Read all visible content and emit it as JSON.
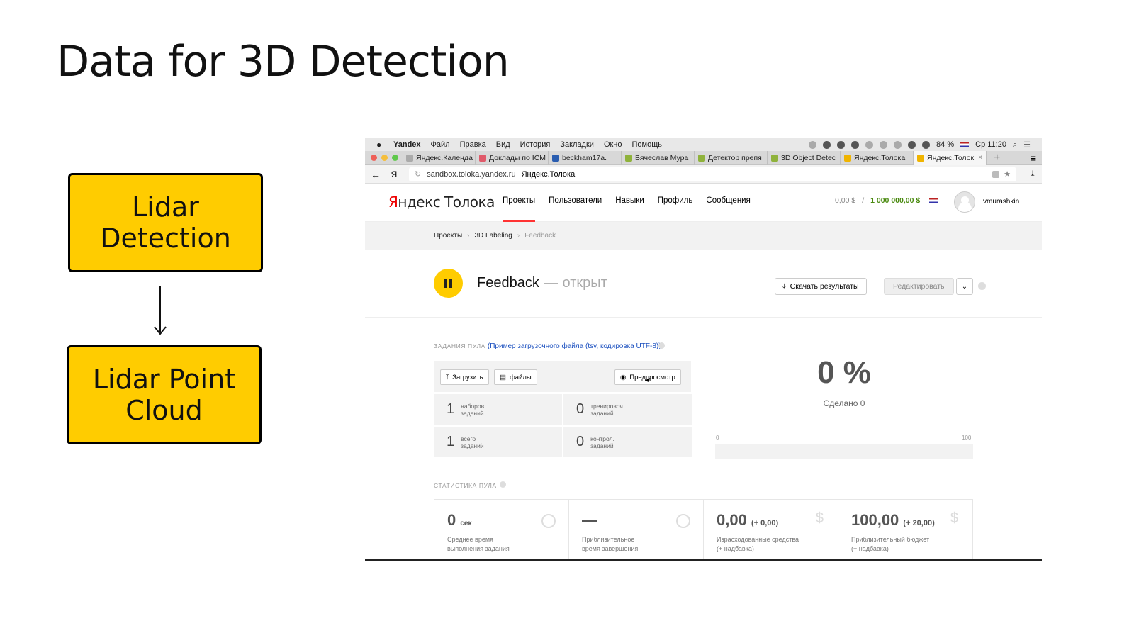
{
  "slide": {
    "title": "Data for 3D Detection",
    "box1": "Lidar\nDetection",
    "box2": "Lidar Point\nCloud"
  },
  "mac_menubar": {
    "app": "Yandex",
    "items": [
      "Файл",
      "Правка",
      "Вид",
      "История",
      "Закладки",
      "Окно",
      "Помощь"
    ],
    "battery": "84 %",
    "clock": "Ср 11:20"
  },
  "tabs": [
    {
      "label": "Яндекс.Календа",
      "color": "#aaaaaa"
    },
    {
      "label": "Доклады по ICM",
      "color": "#e05a6a"
    },
    {
      "label": "beckham17a.",
      "color": "#2a5db0"
    },
    {
      "label": "Вячеслав Мура",
      "color": "#8fb23b"
    },
    {
      "label": "Детектор препя",
      "color": "#8fb23b"
    },
    {
      "label": "3D Object Detec",
      "color": "#8fb23b"
    },
    {
      "label": "Яндекс.Толока",
      "color": "#f0b400"
    },
    {
      "label": "Яндекс.Толок",
      "color": "#f0b400",
      "active": true
    }
  ],
  "address": {
    "host": "sandbox.toloka.yandex.ru",
    "page_title": "Яндекс.Толока"
  },
  "header": {
    "logo_red": "Я",
    "logo_rest": "ндекс Толока",
    "nav": [
      "Проекты",
      "Пользователи",
      "Навыки",
      "Профиль",
      "Сообщения"
    ],
    "balance_zero": "0,00 $",
    "balance_sep": "/",
    "balance_main": "1 000 000,00 $",
    "username": "vmurashkin"
  },
  "breadcrumbs": [
    "Проекты",
    "3D Labeling",
    "Feedback"
  ],
  "pool": {
    "title": "Feedback",
    "status": "— открыт",
    "download_label": "Скачать результаты",
    "edit_label": "Редактировать"
  },
  "tasks": {
    "section_label": "Задания пула",
    "section_link": "(Пример загрузочного файла (tsv, кодировка UTF-8))",
    "upload_label": "Загрузить",
    "files_label": "файлы",
    "preview_label": "Предпросмотр",
    "cells": [
      {
        "n": "1",
        "t": "наборов\nзаданий"
      },
      {
        "n": "0",
        "t": "тренировоч.\nзаданий"
      },
      {
        "n": "1",
        "t": "всего\nзаданий"
      },
      {
        "n": "0",
        "t": "контрол.\nзаданий"
      }
    ]
  },
  "progress": {
    "percent_text": "0 %",
    "done_text": "Сделано 0",
    "value": 0,
    "min_label": "0",
    "max_label": "100"
  },
  "stats": {
    "section_label": "Статистика пула",
    "boxes": [
      {
        "value": "0",
        "unit": "сек",
        "extra": "",
        "desc": "Среднее время\nвыполнения задания",
        "icon": "clock-icon"
      },
      {
        "value": "—",
        "unit": "",
        "extra": "",
        "desc": "Приблизительное\nвремя завершения",
        "icon": "clock-icon"
      },
      {
        "value": "0,00",
        "unit": "",
        "extra": "(+ 0,00)",
        "desc": "Израсходованные средства\n(+ надбавка)",
        "icon": "dollar-icon"
      },
      {
        "value": "100,00",
        "unit": "",
        "extra": "(+ 20,00)",
        "desc": "Приблизительный бюджет\n(+ надбавка)",
        "icon": "dollar-icon"
      }
    ]
  },
  "colors": {
    "accent_yellow": "#ffcc00",
    "balance_green": "#4a8a0f",
    "link_blue": "#1a4fbf"
  }
}
